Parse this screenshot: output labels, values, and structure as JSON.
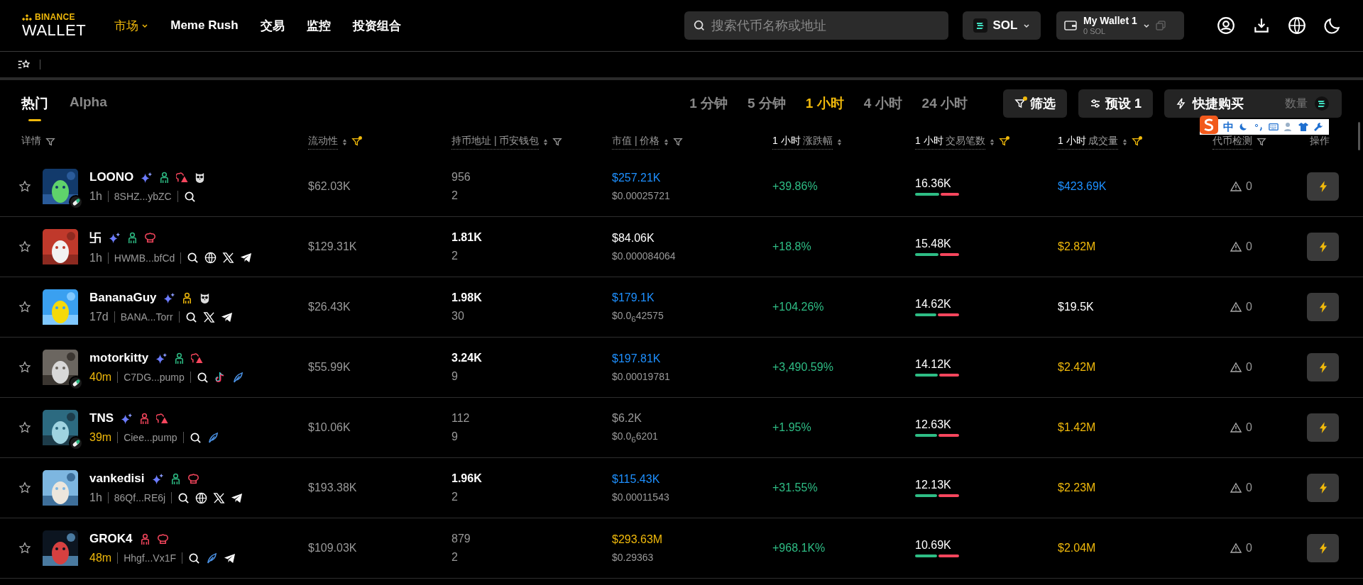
{
  "logo": {
    "brand": "BINANCE",
    "product": "WALLET"
  },
  "nav": [
    {
      "label": "市场",
      "selected": true,
      "dropdown": true
    },
    {
      "label": "Meme Rush",
      "selected": false,
      "dropdown": false
    },
    {
      "label": "交易",
      "selected": false,
      "dropdown": false
    },
    {
      "label": "监控",
      "selected": false,
      "dropdown": false
    },
    {
      "label": "投资组合",
      "selected": false,
      "dropdown": false
    }
  ],
  "search": {
    "placeholder": "搜索代币名称或地址"
  },
  "chain": {
    "label": "SOL"
  },
  "wallet": {
    "name": "My Wallet 1",
    "balance": "0 SOL"
  },
  "tabs": [
    {
      "label": "热门",
      "selected": true
    },
    {
      "label": "Alpha",
      "selected": false
    }
  ],
  "timeframes": [
    {
      "label": "1 分钟",
      "selected": false
    },
    {
      "label": "5 分钟",
      "selected": false
    },
    {
      "label": "1 小时",
      "selected": true
    },
    {
      "label": "4 小时",
      "selected": false
    },
    {
      "label": "24 小时",
      "selected": false
    }
  ],
  "actions": {
    "filter": {
      "label": "筛选",
      "active": true
    },
    "preset": {
      "label": "预设 1"
    },
    "quick_buy": {
      "label": "快捷购买",
      "amount_placeholder": "数量"
    }
  },
  "ime_toolbar": {
    "mode": "中"
  },
  "columns": [
    {
      "label": "详情",
      "sortable": false,
      "filter_active": false
    },
    {
      "label": "流动性",
      "sortable": true,
      "filter_active": true
    },
    {
      "label": "持币地址 | 币安钱包",
      "sortable": true,
      "filter_active": false
    },
    {
      "label": "市值 | 价格",
      "sortable": true,
      "filter_active": false
    },
    {
      "label": "涨跌幅",
      "prefix": "1 小时",
      "sortable": true
    },
    {
      "label": "交易笔数",
      "prefix": "1 小时",
      "sortable": true,
      "filter_active": true
    },
    {
      "label": "成交量",
      "prefix": "1 小时",
      "sortable": true,
      "filter_active": true
    },
    {
      "label": "代币检测",
      "sortable": false,
      "filter_active": false
    },
    {
      "label": "操作",
      "sortable": false
    }
  ],
  "rows": [
    {
      "name": "LOONO",
      "avatar": {
        "kind": "picture"
      },
      "pill": true,
      "age": {
        "text": "1h",
        "color": "#9a9a9a"
      },
      "address": "8SHZ...ybZC",
      "badges": [
        {
          "kind": "sparkle"
        },
        {
          "kind": "person",
          "color": "#2ebd85"
        },
        {
          "kind": "hat-alert",
          "color": "#f6465d"
        },
        {
          "kind": "owl"
        }
      ],
      "links": [
        {
          "kind": "search"
        }
      ],
      "liquidity": "$62.03K",
      "holders": {
        "text": "956",
        "highlighted": false
      },
      "binance_wallets": "2",
      "market_cap": {
        "text": "$257.21K",
        "color": "#1e90ff"
      },
      "price": "$0.00025721",
      "change": "+39.86%",
      "txns": "16.36K",
      "level": 0.55,
      "volume": {
        "text": "$423.69K",
        "color": "#1e90ff"
      },
      "checks": "0"
    },
    {
      "name": "卐",
      "avatar": {
        "kind": "picture"
      },
      "pill": false,
      "age": {
        "text": "1h",
        "color": "#9a9a9a"
      },
      "address": "HWMB...bfCd",
      "badges": [
        {
          "kind": "sparkle"
        },
        {
          "kind": "person",
          "color": "#2ebd85"
        },
        {
          "kind": "chef",
          "color": "#f6465d"
        }
      ],
      "links": [
        {
          "kind": "search"
        },
        {
          "kind": "globe"
        },
        {
          "kind": "x"
        },
        {
          "kind": "telegram"
        }
      ],
      "liquidity": "$129.31K",
      "holders": {
        "text": "1.81K",
        "highlighted": true
      },
      "binance_wallets": "2",
      "market_cap": {
        "text": "$84.06K",
        "color": "#ffffff"
      },
      "price": "$0.000084064",
      "change": "+18.8%",
      "txns": "15.48K",
      "level": 0.53,
      "volume": {
        "text": "$2.82M",
        "color": "#f0b90b"
      },
      "checks": "0"
    },
    {
      "name": "BananaGuy",
      "avatar": {
        "kind": "picture"
      },
      "pill": false,
      "age": {
        "text": "17d",
        "color": "#9a9a9a"
      },
      "address": "BANA...Torr",
      "badges": [
        {
          "kind": "sparkle"
        },
        {
          "kind": "person",
          "color": "#f0b90b"
        },
        {
          "kind": "owl"
        }
      ],
      "links": [
        {
          "kind": "search"
        },
        {
          "kind": "x"
        },
        {
          "kind": "telegram"
        }
      ],
      "liquidity": "$26.43K",
      "holders": {
        "text": "1.98K",
        "highlighted": true
      },
      "binance_wallets": "30",
      "market_cap": {
        "text": "$179.1K",
        "color": "#1e90ff"
      },
      "price": "$0.0$_{6}$42575",
      "change": "+104.26%",
      "txns": "14.62K",
      "level": 0.48,
      "volume": {
        "text": "$19.5K",
        "color": "#ffffff"
      },
      "checks": "0"
    },
    {
      "name": "motorkitty",
      "avatar": {
        "kind": "picture"
      },
      "pill": true,
      "age": {
        "text": "40m",
        "color": "#f0b90b"
      },
      "address": "C7DG...pump",
      "badges": [
        {
          "kind": "sparkle"
        },
        {
          "kind": "person",
          "color": "#2ebd85"
        },
        {
          "kind": "hat-alert",
          "color": "#f6465d"
        }
      ],
      "links": [
        {
          "kind": "search"
        },
        {
          "kind": "tiktok"
        },
        {
          "kind": "feather"
        }
      ],
      "liquidity": "$55.99K",
      "holders": {
        "text": "3.24K",
        "highlighted": true
      },
      "binance_wallets": "9",
      "market_cap": {
        "text": "$197.81K",
        "color": "#1e90ff"
      },
      "price": "$0.00019781",
      "change": "+3,490.59%",
      "txns": "14.12K",
      "level": 0.52,
      "volume": {
        "text": "$2.42M",
        "color": "#f0b90b"
      },
      "checks": "0"
    },
    {
      "name": "TNS",
      "avatar": {
        "kind": "picture"
      },
      "pill": true,
      "age": {
        "text": "39m",
        "color": "#f0b90b"
      },
      "address": "Ciee...pump",
      "badges": [
        {
          "kind": "sparkle"
        },
        {
          "kind": "person",
          "color": "#f6465d"
        },
        {
          "kind": "hat-alert",
          "color": "#f6465d"
        }
      ],
      "links": [
        {
          "kind": "search"
        },
        {
          "kind": "feather"
        }
      ],
      "liquidity": "$10.06K",
      "holders": {
        "text": "112",
        "highlighted": false
      },
      "binance_wallets": "9",
      "market_cap": {
        "text": "$6.2K",
        "color": "#9a9a9a"
      },
      "price": "$0.0$_{6}$6201",
      "change": "+1.95%",
      "txns": "12.63K",
      "level": 0.5,
      "volume": {
        "text": "$1.42M",
        "color": "#f0b90b"
      },
      "checks": "0"
    },
    {
      "name": "vankedisi",
      "avatar": {
        "kind": "picture"
      },
      "pill": false,
      "age": {
        "text": "1h",
        "color": "#9a9a9a"
      },
      "address": "86Qf...RE6j",
      "badges": [
        {
          "kind": "sparkle"
        },
        {
          "kind": "person",
          "color": "#2ebd85"
        },
        {
          "kind": "chef",
          "color": "#f6465d"
        }
      ],
      "links": [
        {
          "kind": "search"
        },
        {
          "kind": "globe"
        },
        {
          "kind": "x"
        },
        {
          "kind": "telegram"
        }
      ],
      "liquidity": "$193.38K",
      "holders": {
        "text": "1.96K",
        "highlighted": true
      },
      "binance_wallets": "2",
      "market_cap": {
        "text": "$115.43K",
        "color": "#1e90ff"
      },
      "price": "$0.00011543",
      "change": "+31.55%",
      "txns": "12.13K",
      "level": 0.5,
      "volume": {
        "text": "$2.23M",
        "color": "#f0b90b"
      },
      "checks": "0"
    },
    {
      "name": "GROK4",
      "avatar": {
        "kind": "picture"
      },
      "pill": false,
      "age": {
        "text": "48m",
        "color": "#f0b90b"
      },
      "address": "Hhgf...Vx1F",
      "badges": [
        {
          "kind": "person",
          "color": "#f6465d"
        },
        {
          "kind": "chef",
          "color": "#f6465d"
        }
      ],
      "links": [
        {
          "kind": "search"
        },
        {
          "kind": "feather"
        },
        {
          "kind": "telegram"
        }
      ],
      "liquidity": "$109.03K",
      "holders": {
        "text": "879",
        "highlighted": false
      },
      "binance_wallets": "2",
      "market_cap": {
        "text": "$293.63M",
        "color": "#f0b90b"
      },
      "price": "$0.29363",
      "change": "+968.1K%",
      "txns": "10.69K",
      "level": 0.5,
      "volume": {
        "text": "$2.04M",
        "color": "#f0b90b"
      },
      "checks": "0"
    }
  ]
}
